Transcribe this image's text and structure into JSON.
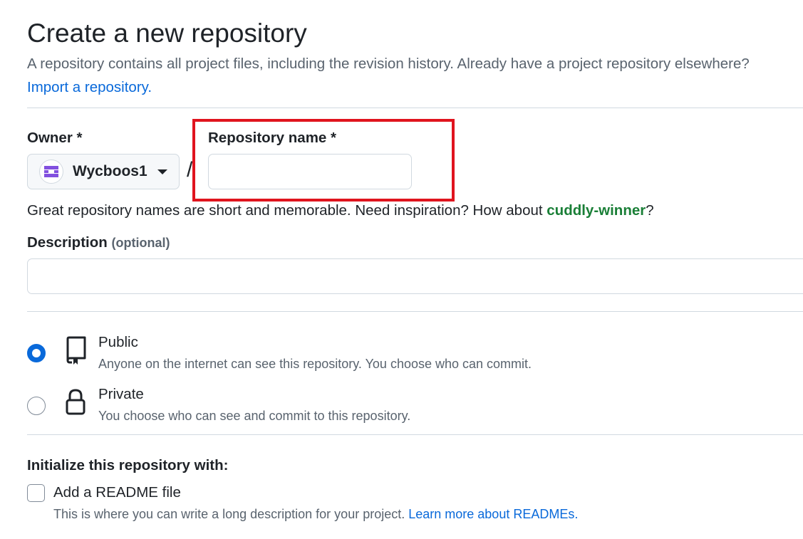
{
  "header": {
    "title": "Create a new repository",
    "subtitle": "A repository contains all project files, including the revision history. Already have a project repository elsewhere?",
    "import_link": "Import a repository."
  },
  "owner": {
    "label": "Owner *",
    "value": "Wycboos1",
    "avatar_icon": "identicon-avatar",
    "avatar_color": "#8250df"
  },
  "separator": "/",
  "repo_name": {
    "label": "Repository name *",
    "value": "",
    "highlight_color": "#e0141e"
  },
  "hint": {
    "text": "Great repository names are short and memorable. Need inspiration? How about ",
    "suggestion": "cuddly-winner",
    "suffix": "?"
  },
  "description": {
    "label": "Description",
    "optional": "(optional)",
    "value": ""
  },
  "visibility": {
    "public": {
      "title": "Public",
      "description": "Anyone on the internet can see this repository. You choose who can commit.",
      "icon": "repo-icon",
      "selected": true
    },
    "private": {
      "title": "Private",
      "description": "You choose who can see and commit to this repository.",
      "icon": "lock-icon",
      "selected": false
    }
  },
  "initialize": {
    "heading": "Initialize this repository with:",
    "readme_label": "Add a README file",
    "readme_checked": false,
    "readme_description": "This is where you can write a long description for your project. ",
    "readme_link": "Learn more about READMEs."
  },
  "colors": {
    "accent": "#0969da",
    "success": "#1a7f37",
    "muted": "#59636e"
  }
}
